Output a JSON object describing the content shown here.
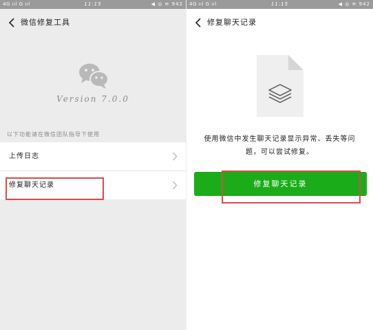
{
  "left": {
    "status_left": "4G ııl G ııl",
    "status_time": "11:15",
    "status_right": "◀ ◎ ≋ 942",
    "title": "微信修复工具",
    "version": "Version 7.0.0",
    "hint": "以下功能请在微信团队指导下使用",
    "items": [
      {
        "label": "上传日志"
      },
      {
        "label": "修复聊天记录"
      }
    ]
  },
  "right": {
    "status_left": "4G ııl G ııl",
    "status_time": "11:15",
    "status_right": "◀ ◎ ≋ 942",
    "title": "修复聊天记录",
    "description": "使用微信中发生聊天记录显示异常、丢失等问题，可以尝试修复。",
    "button_label": "修复聊天记录"
  },
  "colors": {
    "accent_green": "#1aad19",
    "highlight_red": "#d94a4a"
  },
  "icons": [
    "back-arrow-icon",
    "wechat-logo-icon",
    "chevron-right-icon",
    "file-stack-icon"
  ]
}
